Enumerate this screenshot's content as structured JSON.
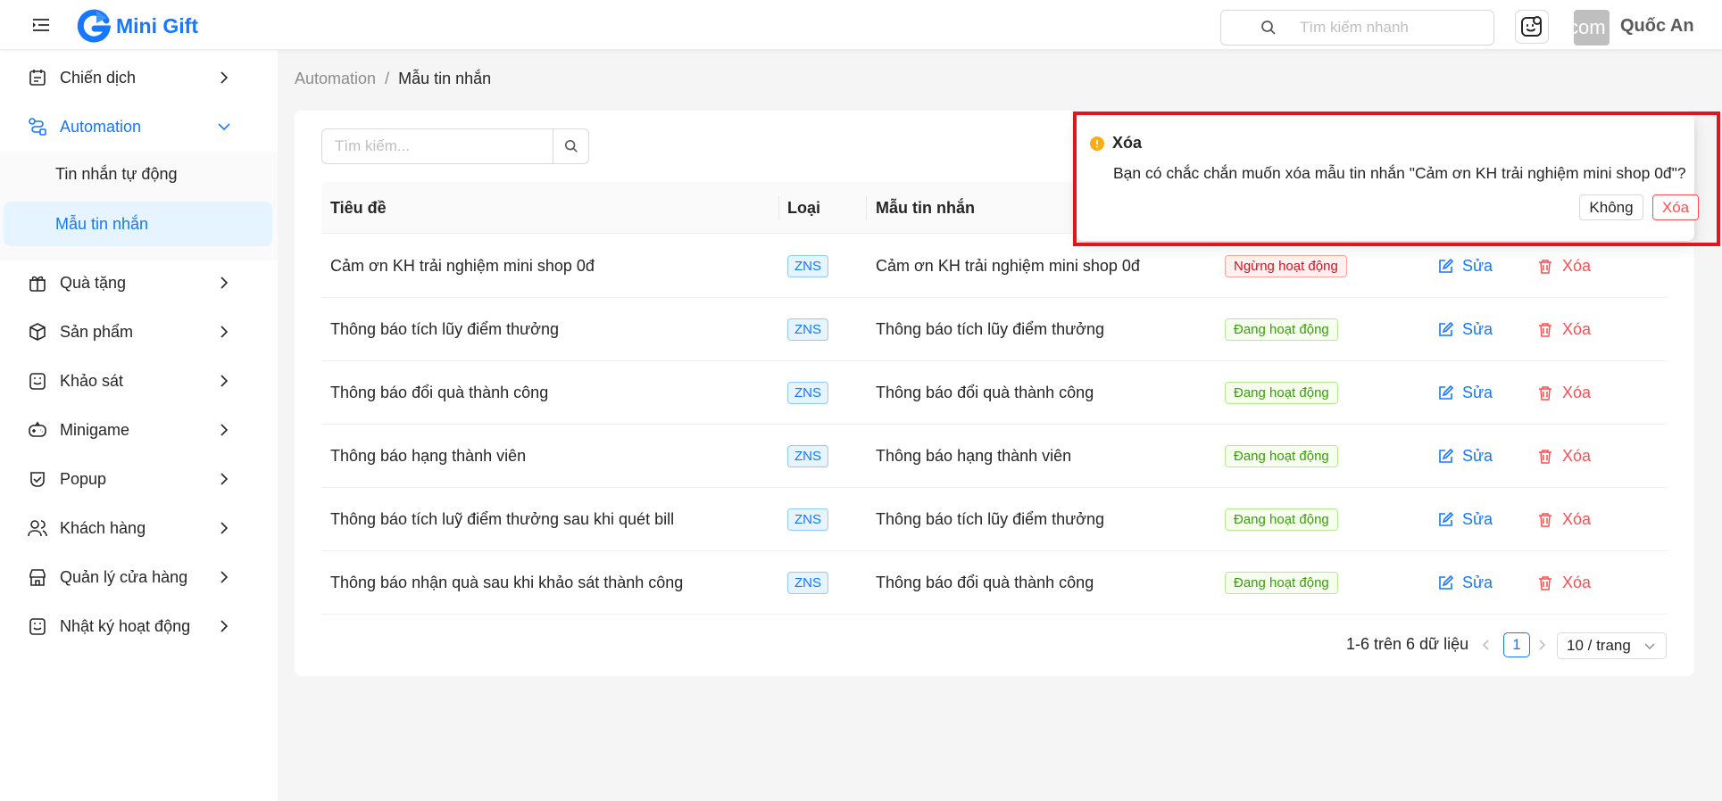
{
  "app": {
    "name": "Mini Gift",
    "brand_color": "#1677ff"
  },
  "header": {
    "search_placeholder": "Tìm kiếm nhanh",
    "avatar_text": "com",
    "user_name": "Quốc An"
  },
  "sidebar": {
    "items": [
      {
        "label": "Chiến dịch",
        "icon": "campaign-icon"
      },
      {
        "label": "Automation",
        "icon": "automation-icon",
        "expanded": true
      },
      {
        "label": "Quà tặng",
        "icon": "gift-icon"
      },
      {
        "label": "Sản phẩm",
        "icon": "product-box-icon"
      },
      {
        "label": "Khảo sát",
        "icon": "survey-icon"
      },
      {
        "label": "Minigame",
        "icon": "game-controller-icon"
      },
      {
        "label": "Popup",
        "icon": "popup-icon"
      },
      {
        "label": "Khách hàng",
        "icon": "customers-icon"
      },
      {
        "label": "Quản lý cửa hàng",
        "icon": "store-icon"
      },
      {
        "label": "Nhật ký hoạt động",
        "icon": "activity-log-icon"
      }
    ],
    "sub_items": [
      {
        "label": "Tin nhắn tự động"
      },
      {
        "label": "Mẫu tin nhắn",
        "selected": true
      }
    ]
  },
  "breadcrumb": {
    "parent": "Automation",
    "separator": "/",
    "current": "Mẫu tin nhắn"
  },
  "table": {
    "search_placeholder": "Tìm kiếm...",
    "columns": [
      "Tiêu đề",
      "Loại",
      "Mẫu tin nhắn"
    ],
    "rows": [
      {
        "title": "Cảm ơn KH trải nghiệm mini shop 0đ",
        "type": "ZNS",
        "template": "Cảm ơn KH trải nghiệm mini shop 0đ",
        "status": "Ngừng hoạt động",
        "active": false
      },
      {
        "title": "Thông báo tích lũy điểm thưởng",
        "type": "ZNS",
        "template": "Thông báo tích lũy điểm thưởng",
        "status": "Đang hoạt động",
        "active": true
      },
      {
        "title": "Thông báo đổi quà thành công",
        "type": "ZNS",
        "template": "Thông báo đổi quà thành công",
        "status": "Đang hoạt động",
        "active": true
      },
      {
        "title": "Thông báo hạng thành viên",
        "type": "ZNS",
        "template": "Thông báo hạng thành viên",
        "status": "Đang hoạt động",
        "active": true
      },
      {
        "title": "Thông báo tích luỹ điểm thưởng sau khi quét bill",
        "type": "ZNS",
        "template": "Thông báo tích lũy điểm thưởng",
        "status": "Đang hoạt động",
        "active": true
      },
      {
        "title": "Thông báo nhận quà sau khi khảo sát thành công",
        "type": "ZNS",
        "template": "Thông báo đổi quà thành công",
        "status": "Đang hoạt động",
        "active": true
      }
    ],
    "edit_label": "Sửa",
    "delete_label": "Xóa"
  },
  "pagination": {
    "total_text": "1-6 trên 6 dữ liệu",
    "current_page": "1",
    "page_size": "10 / trang"
  },
  "popconfirm": {
    "title": "Xóa",
    "message": "Bạn có chắc chắn muốn xóa mẫu tin nhắn \"Cảm ơn KH trải nghiệm mini shop 0đ\"?",
    "cancel_label": "Không",
    "confirm_label": "Xóa",
    "warning_color": "#faad14",
    "highlight_color": "#e4141e"
  },
  "colors": {
    "active_status": "#389e0d",
    "inactive_status": "#cf1322",
    "delete": "#ff4d4f"
  }
}
